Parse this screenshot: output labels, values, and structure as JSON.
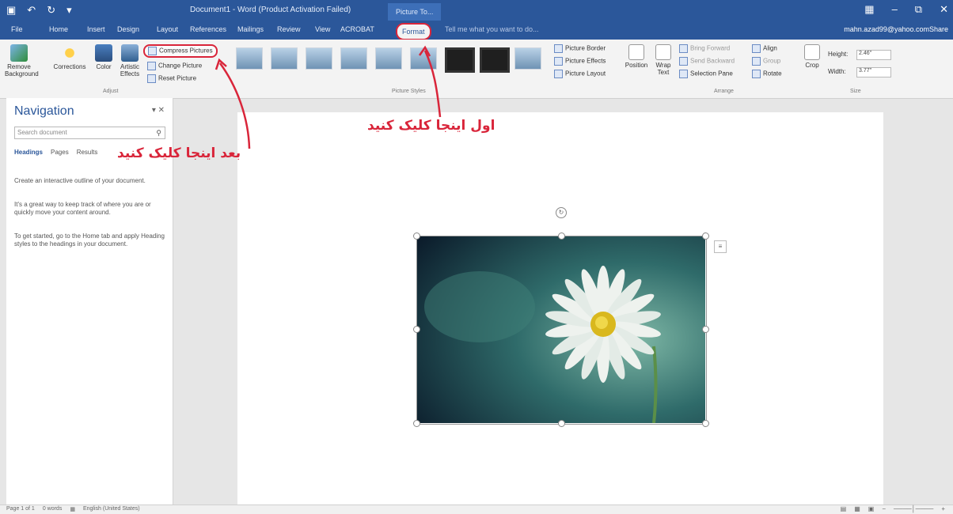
{
  "window": {
    "title": "Document1 - Word (Product Activation Failed)",
    "picture_tools": "Picture To...",
    "qat_icons": [
      "save-icon",
      "undo-icon",
      "redo-icon",
      "customize-icon"
    ],
    "controls": [
      "ribbon-display-icon",
      "minimize-icon",
      "restore-icon",
      "close-icon"
    ]
  },
  "tabs": [
    "File",
    "Home",
    "Insert",
    "Design",
    "Layout",
    "References",
    "Mailings",
    "Review",
    "View",
    "ACROBAT"
  ],
  "format_tab": "Format",
  "tell_me": "Tell me what you want to do...",
  "account": "mahn.azad99@yahoo.com",
  "share": "Share",
  "ribbon": {
    "remove_background": "Remove Background",
    "corrections": "Corrections",
    "color": "Color",
    "artistic_effects": "Artistic Effects",
    "compress_pictures": "Compress Pictures",
    "change_picture": "Change Picture",
    "reset_picture": "Reset Picture",
    "adjust_label": "Adjust",
    "picture_styles_label": "Picture Styles",
    "picture_border": "Picture Border",
    "picture_effects": "Picture Effects",
    "picture_layout": "Picture Layout",
    "position": "Position",
    "wrap_text": "Wrap Text",
    "bring_forward": "Bring Forward",
    "send_backward": "Send Backward",
    "selection_pane": "Selection Pane",
    "align": "Align",
    "group": "Group",
    "rotate": "Rotate",
    "arrange_label": "Arrange",
    "crop": "Crop",
    "height_label": "Height:",
    "height_value": "2.46\"",
    "width_label": "Width:",
    "width_value": "3.77\"",
    "size_label": "Size"
  },
  "navigation": {
    "title": "Navigation",
    "search_placeholder": "Search document",
    "tabs": [
      "Headings",
      "Pages",
      "Results"
    ],
    "para1": "Create an interactive outline of your document.",
    "para2": "It's a great way to keep track of where you are or quickly move your content around.",
    "para3": "To get started, go to the Home tab and apply Heading styles to the headings in your document."
  },
  "annotations": {
    "first": "اول اینجا کلیک کنید",
    "second": "بعد اینجا کلیک کنید"
  },
  "status": {
    "page": "Page 1 of 1",
    "words": "0 words",
    "language": "English (United States)"
  },
  "colors": {
    "accent": "#2b579a",
    "annotation": "#d9253a"
  }
}
